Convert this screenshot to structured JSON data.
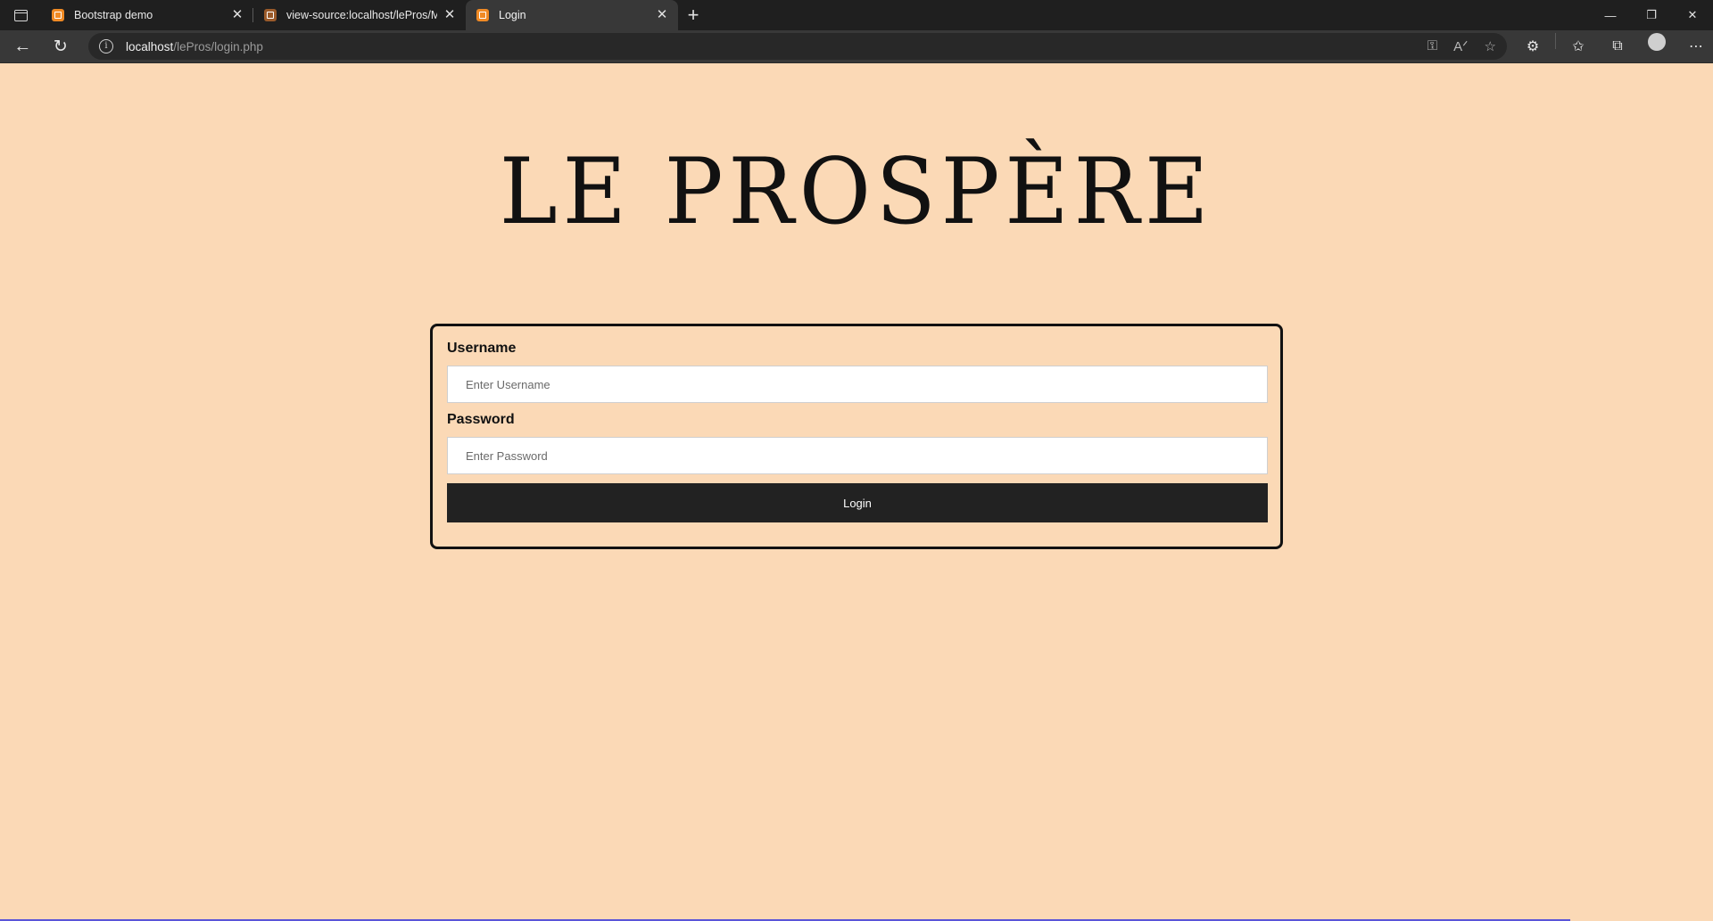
{
  "browser": {
    "tabs": [
      {
        "title": "Bootstrap demo",
        "active": false
      },
      {
        "title": "view-source:localhost/lePros/Ma",
        "active": false
      },
      {
        "title": "Login",
        "active": true
      }
    ],
    "url_host": "localhost",
    "url_path": "/lePros/login.php"
  },
  "page": {
    "brand": "LE PROSPÈRE",
    "username_label": "Username",
    "username_placeholder": "Enter Username",
    "password_label": "Password",
    "password_placeholder": "Enter Password",
    "login_button": "Login"
  },
  "colors": {
    "background": "#fbd9b6",
    "button": "#222222",
    "chrome": "#383838"
  }
}
